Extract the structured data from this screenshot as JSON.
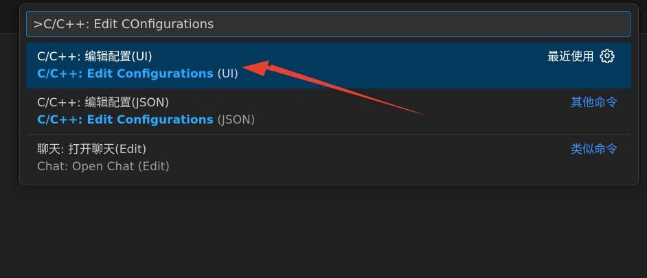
{
  "command_palette": {
    "input_value": ">C/C++: Edit COnfigurations",
    "items": [
      {
        "label": "C/C++: 编辑配置(UI)",
        "detail_highlight": "C/C++: Edit Configurations",
        "detail_rest": " (UI)",
        "group_label": "最近使用",
        "icon": "gear-icon",
        "selected": true
      },
      {
        "label": "C/C++: 编辑配置(JSON)",
        "detail_highlight": "C/C++: Edit Configurations",
        "detail_rest": " (JSON)",
        "group_label": "其他命令"
      },
      {
        "label": "聊天: 打开聊天(Edit)",
        "detail_plain": "Chat: Open Chat (Edit)",
        "group_label": "类似命令"
      }
    ]
  },
  "colors": {
    "selection_bg": "#04395e",
    "highlight": "#2aaaff",
    "group_label": "#3794ff",
    "annotation_arrow": "#e8412f"
  }
}
